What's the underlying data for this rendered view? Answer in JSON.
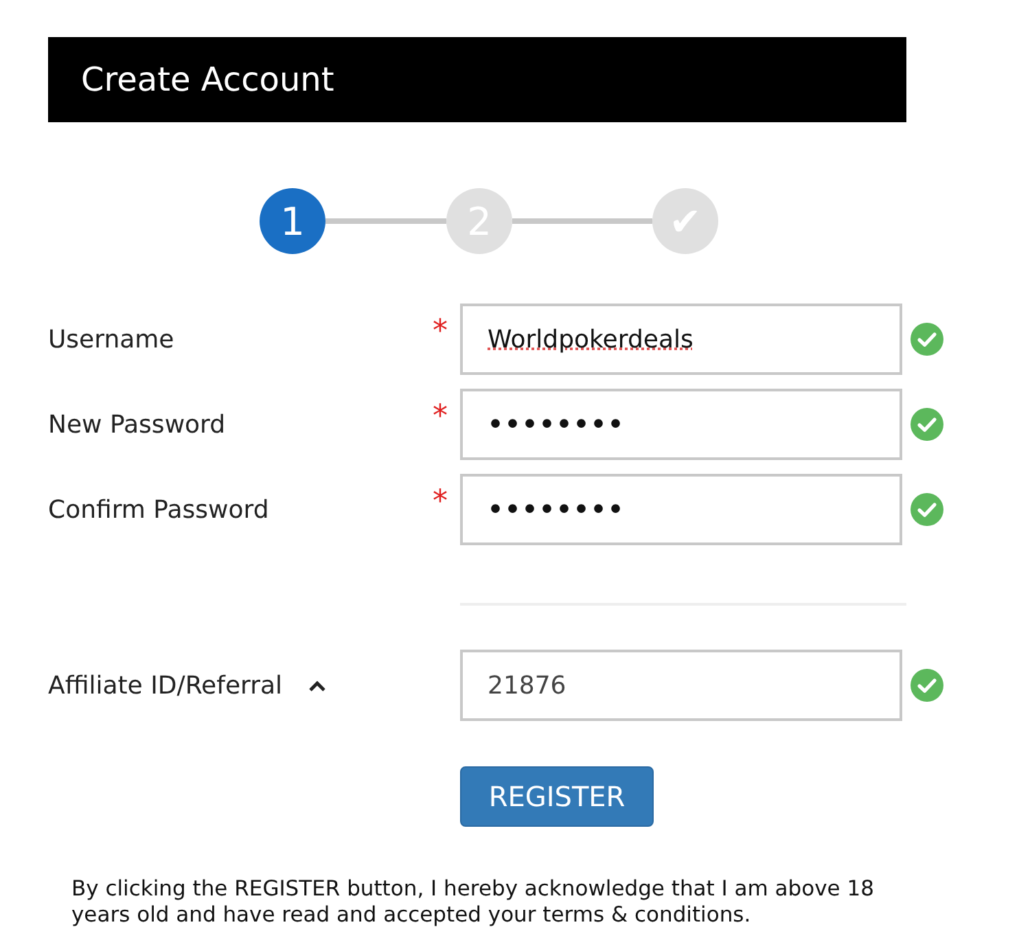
{
  "header": {
    "title": "Create Account"
  },
  "steps": [
    {
      "label": "1",
      "selected": true
    },
    {
      "label": "2",
      "selected": false
    },
    {
      "label": "✔",
      "selected": false
    }
  ],
  "fields": [
    {
      "label": "Username",
      "required_mark": "*",
      "value": "Worldpokerdeals",
      "valid": true,
      "spellcheck_flag": true
    },
    {
      "label": "New Password",
      "required_mark": "*",
      "value": "••••••••",
      "valid": true,
      "spellcheck_flag": false
    },
    {
      "label": "Confirm Password",
      "required_mark": "*",
      "value": "••••••••",
      "valid": true,
      "spellcheck_flag": false
    }
  ],
  "affiliate": {
    "label": "Affiliate ID/Referral",
    "expanded": true,
    "value": "21876",
    "valid": true
  },
  "register_button": "REGISTER",
  "notice": "By clicking the REGISTER button, I hereby acknowledge that I am above 18 years old and have read and accepted your terms & conditions."
}
